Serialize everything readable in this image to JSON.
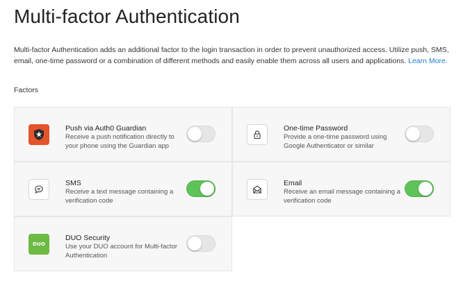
{
  "page": {
    "title": "Multi-factor Authentication",
    "description": "Multi-factor Authentication adds an additional factor to the login transaction in order to prevent unauthorized access. Utilize push, SMS, email, one-time password or a combination of different methods and easily enable them across all users and applications.",
    "learn_more": "Learn More.",
    "section_label": "Factors"
  },
  "colors": {
    "toggle_on": "#5fc35a",
    "guardian_brand": "#e5532d",
    "duo_brand": "#6dbb45",
    "link": "#1e7dd0"
  },
  "factors": [
    {
      "name": "Push via Auth0 Guardian",
      "description": "Receive a push notification directly to your phone using the Guardian app",
      "icon": "guardian-logo-icon",
      "enabled": false
    },
    {
      "name": "One-time Password",
      "description": "Provide a one-time password using Google Authenticator or similar",
      "icon": "lock-icon",
      "enabled": false
    },
    {
      "name": "SMS",
      "description": "Receive a text message containing a verification code",
      "icon": "chat-bubble-icon",
      "enabled": true
    },
    {
      "name": "Email",
      "description": "Receive an email message containing a verification code",
      "icon": "envelope-icon",
      "enabled": true
    },
    {
      "name": "DUO Security",
      "description": "Use your DUO account for Multi-factor Authentication",
      "icon": "duo-logo-icon",
      "enabled": false,
      "logo_text": "DUO"
    }
  ]
}
